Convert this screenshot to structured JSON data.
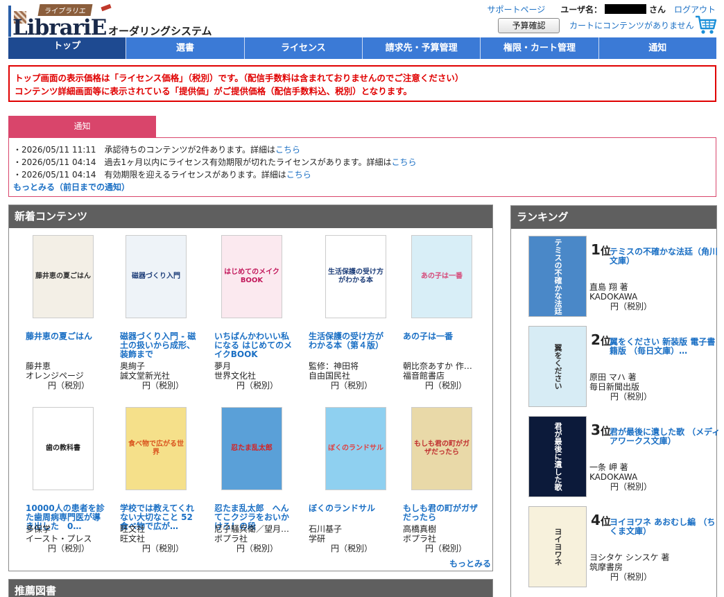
{
  "header": {
    "logo_tag": "ライブラリエ",
    "logo_name": "LibrariE",
    "logo_sub": "オーダリングシステム",
    "support": "サポートページ",
    "user_label": "ユーザ名：",
    "san": "さん",
    "logout": "ログアウト",
    "budget_button": "予算確認",
    "cart_text": "カートにコンテンツがありません"
  },
  "nav": [
    {
      "label": "トップ"
    },
    {
      "label": "選書"
    },
    {
      "label": "ライセンス"
    },
    {
      "label": "請求先・予算管理"
    },
    {
      "label": "権限・カート管理"
    },
    {
      "label": "通知"
    }
  ],
  "notice": {
    "line1": "トップ画面の表示価格は「ライセンス価格」（税別）です。（配信手数料は含まれておりませんのでご注意ください）",
    "line2": "コンテンツ詳細画面等に表示されている「提供価」がご提供価格（配信手数料込、税別）となります。"
  },
  "announcements": {
    "tab": "通知",
    "items": [
      {
        "text": "・2026/05/11 11:11　承認待ちのコンテンツが2件あります。詳細は",
        "link": "こちら"
      },
      {
        "text": "・2026/05/11 04:14　過去1ヶ月以内にライセンス有効期限が切れたライセンスがあります。詳細は",
        "link": "こちら"
      },
      {
        "text": "・2026/05/11 04:14　有効期限を迎えるライセンスがあります。詳細は",
        "link": "こちら"
      }
    ],
    "more": "もっとみる（前日までの通知）"
  },
  "new_contents": {
    "title": "新着コンテンツ",
    "more": "もっとみる",
    "books": [
      {
        "title": "藤井恵の夏ごはん",
        "author": "藤井恵",
        "publisher": "オレンジページ",
        "price": "円（税別）",
        "cover_text": "藤井恵の夏ごはん",
        "cover_color": "#f3efe6",
        "text_color": "#333"
      },
      {
        "title": "磁器づくり入門 - 磁土の扱いから成形、装飾まで",
        "author": "奥絢子",
        "publisher": "誠文堂新光社",
        "price": "円（税別）",
        "cover_text": "磁器づくり入門",
        "cover_color": "#eef3f8",
        "text_color": "#1f3f7a"
      },
      {
        "title": "いちばんかわいい私になる はじめてのメイクBOOK",
        "author": "夢月",
        "publisher": "世界文化社",
        "price": "円（税別）",
        "cover_text": "はじめてのメイクBOOK",
        "cover_color": "#fbe9ef",
        "text_color": "#c2185b"
      },
      {
        "title": "生活保護の受け方がわかる本（第４版）",
        "author": "監修：神田将",
        "publisher": "自由国民社",
        "price": "円（税別）",
        "cover_text": "生活保護の受け方がわかる本",
        "cover_color": "#ffffff",
        "text_color": "#1f3f7a"
      },
      {
        "title": "あの子は一番",
        "author": "朝比奈あすか 作…",
        "publisher": "福音館書店",
        "price": "円（税別）",
        "cover_text": "あの子は一番",
        "cover_color": "#d8eef7",
        "text_color": "#d64a7a"
      },
      {
        "title": "10000人の患者を診た歯周病専門医が導き出した　0…",
        "author": "多保学",
        "publisher": "イースト・プレス",
        "price": "円（税別）",
        "cover_text": "歯の教科書",
        "cover_color": "#ffffff",
        "text_color": "#222"
      },
      {
        "title": "学校では教えてくれない大切なこと 52 食べ物で広が…",
        "author": "旺文社",
        "publisher": "旺文社",
        "price": "円（税別）",
        "cover_text": "食べ物で広がる世界",
        "cover_color": "#f5e08a",
        "text_color": "#d9531e"
      },
      {
        "title": "忍たま乱太郎　へんてこクジラをおいかけろ！の段",
        "author": "尼子騒兵衛／望月…",
        "publisher": "ポプラ社",
        "price": "円（税別）",
        "cover_text": "忍たま乱太郎",
        "cover_color": "#5aa0d8",
        "text_color": "#d62020"
      },
      {
        "title": "ぼくのランドサル",
        "author": "石川基子",
        "publisher": "学研",
        "price": "円（税別）",
        "cover_text": "ぼくのランドサル",
        "cover_color": "#8fd0f0",
        "text_color": "#e04040"
      },
      {
        "title": "もしも君の町がガザだったら",
        "author": "高橋真樹",
        "publisher": "ポプラ社",
        "price": "円（税別）",
        "cover_text": "もしも君の町がガザだったら",
        "cover_color": "#e9d9a8",
        "text_color": "#c03030"
      }
    ]
  },
  "recommended": {
    "title": "推薦図書"
  },
  "ranking": {
    "title": "ランキング",
    "items": [
      {
        "rank": "1",
        "unit": "位",
        "title": "テミスの不確かな法廷（角川文庫）",
        "author": "直島 翔 著",
        "publisher": "KADOKAWA",
        "price": "円（税別）",
        "cover_text": "テミスの不確かな法廷",
        "cover_color": "#4a88c8"
      },
      {
        "rank": "2",
        "unit": "位",
        "title": "翼をください 新装版 電子書籍版 （毎日文庫）…",
        "author": "原田 マハ 著",
        "publisher": "毎日新聞出版",
        "price": "円（税別）",
        "cover_text": "翼をください",
        "cover_color": "#d7ecf5"
      },
      {
        "rank": "3",
        "unit": "位",
        "title": "君が最後に遺した歌 （メディアワークス文庫）",
        "author": "一条 岬 著",
        "publisher": "KADOKAWA",
        "price": "円（税別）",
        "cover_text": "君が最後に遺した歌",
        "cover_color": "#0c1a3a"
      },
      {
        "rank": "4",
        "unit": "位",
        "title": "ヨイヨワネ あおむし編 （ちくま文庫）",
        "author": "ヨシタケ シンスケ 著",
        "publisher": "筑摩書房",
        "price": "円（税別）",
        "cover_text": "ヨイヨワネ",
        "cover_color": "#f7f1dc"
      }
    ]
  }
}
